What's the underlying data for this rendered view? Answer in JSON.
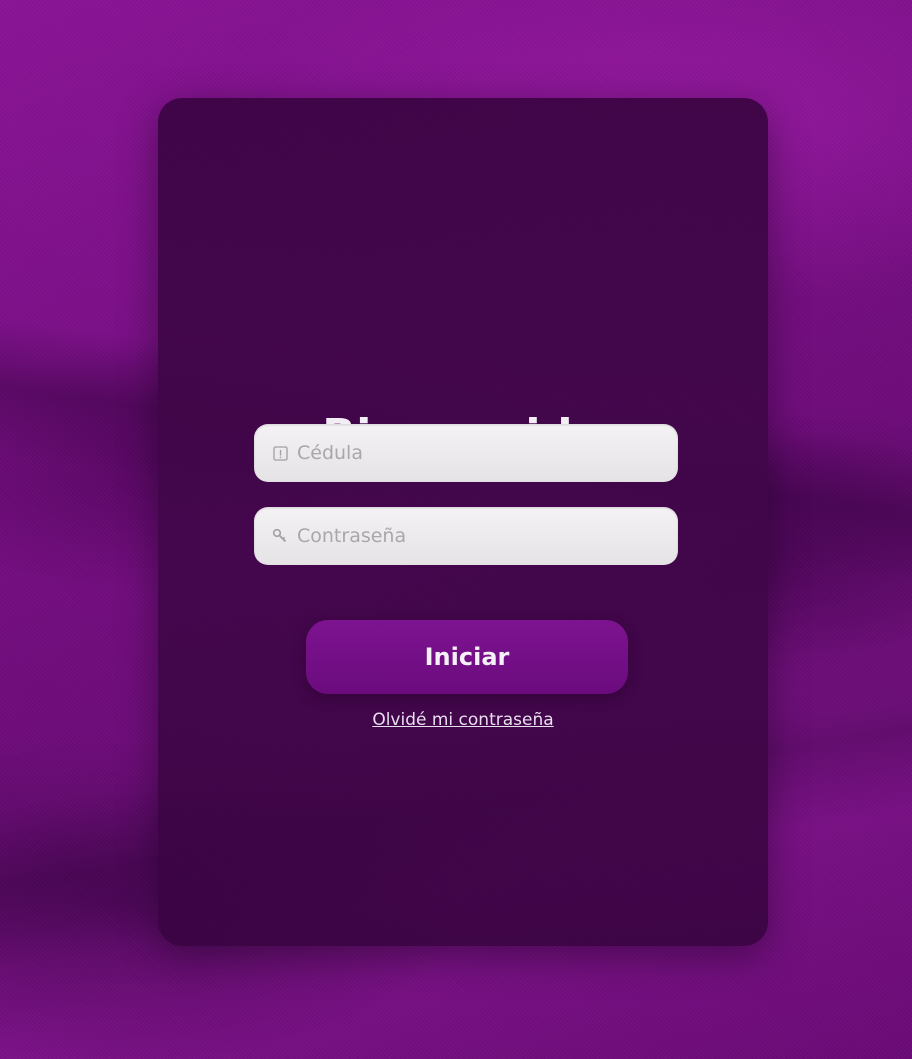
{
  "login": {
    "title": "Bienvenido",
    "cedula_placeholder": "Cédula",
    "password_placeholder": "Contraseña",
    "submit_label": "Iniciar",
    "forgot_link": "Olvidé mi contraseña"
  },
  "icons": {
    "cedula": "id-card-icon",
    "password": "key-icon"
  },
  "colors": {
    "background": "#7a0f86",
    "card": "#3f0648",
    "button": "#740f88",
    "text_light": "#f3eef6"
  }
}
